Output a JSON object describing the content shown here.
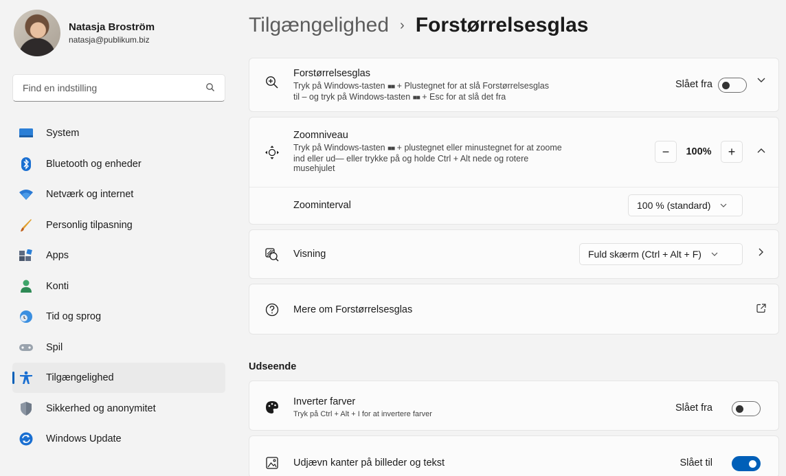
{
  "profile": {
    "name": "Natasja Broström",
    "email": "natasja@publikum.biz"
  },
  "search": {
    "placeholder": "Find en indstilling",
    "icon": "search-icon"
  },
  "sidebar": {
    "items": [
      {
        "label": "System",
        "icon": "system-icon",
        "active": false
      },
      {
        "label": "Bluetooth og enheder",
        "icon": "bluetooth-icon",
        "active": false
      },
      {
        "label": "Netværk og internet",
        "icon": "wifi-icon",
        "active": false
      },
      {
        "label": "Personlig tilpasning",
        "icon": "brush-icon",
        "active": false
      },
      {
        "label": "Apps",
        "icon": "apps-icon",
        "active": false
      },
      {
        "label": "Konti",
        "icon": "account-icon",
        "active": false
      },
      {
        "label": "Tid og sprog",
        "icon": "clock-globe-icon",
        "active": false
      },
      {
        "label": "Spil",
        "icon": "gamepad-icon",
        "active": false
      },
      {
        "label": "Tilgængelighed",
        "icon": "accessibility-icon",
        "active": true
      },
      {
        "label": "Sikkerhed og anonymitet",
        "icon": "shield-icon",
        "active": false
      },
      {
        "label": "Windows Update",
        "icon": "update-icon",
        "active": false
      }
    ]
  },
  "breadcrumb": {
    "parent": "Tilgængelighed",
    "separator": "›",
    "current": "Forstørrelsesglas"
  },
  "magnifier": {
    "title": "Forstørrelsesglas",
    "desc_line1_a": "Tryk på Windows-tasten",
    "desc_line1_b": "+ Plustegnet for at slå Forstørrelsesglas",
    "desc_line2_a": "til – og tryk på Windows-tasten",
    "desc_line2_b": "+ Esc for at slå det fra",
    "win_glyph": "■■",
    "state": "Slået fra",
    "toggle_on": false
  },
  "zoom": {
    "title": "Zoomniveau",
    "desc_line1_a": "Tryk på Windows-tasten",
    "desc_line1_b": "+ plustegnet eller minustegnet for at zoome",
    "desc_line2": "ind eller ud— eller trykke på og holde Ctrl + Alt nede og rotere",
    "desc_line3": "musehjulet",
    "minus": "−",
    "value": "100%",
    "plus": "+",
    "interval_label": "Zoominterval",
    "interval_value": "100 % (standard)"
  },
  "view": {
    "title": "Visning",
    "value": "Fuld skærm (Ctrl + Alt + F)"
  },
  "more": {
    "title": "Mere om Forstørrelsesglas"
  },
  "appearance": {
    "section_title": "Udseende",
    "invert_title": "Inverter farver",
    "invert_desc": "Tryk på Ctrl + Alt + I for at invertere farver",
    "invert_state": "Slået fra",
    "invert_on": false,
    "smooth_title": "Udjævn kanter på billeder og tekst",
    "smooth_state": "Slået til",
    "smooth_on": true
  },
  "colors": {
    "accent": "#005fb8",
    "background": "#f3f3f3",
    "card": "#fbfbfb"
  }
}
